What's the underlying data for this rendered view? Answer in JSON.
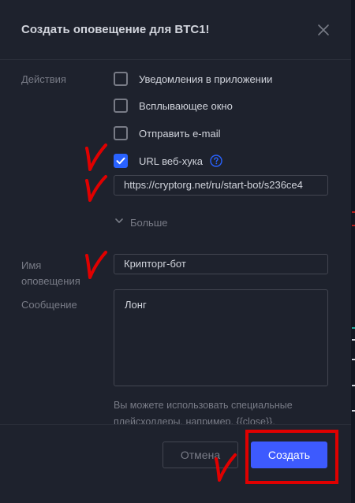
{
  "dialog": {
    "title": "Создать оповещение для BTC1!",
    "close_icon": "close-icon"
  },
  "actions": {
    "label": "Действия",
    "items": [
      {
        "label": "Уведомления в приложении",
        "checked": false
      },
      {
        "label": "Всплывающее окно",
        "checked": false
      },
      {
        "label": "Отправить e-mail",
        "checked": false
      },
      {
        "label": "URL веб-хука",
        "checked": true
      }
    ],
    "webhook_url": "https://cryptorg.net/ru/start-bot/s236ce4",
    "more_label": "Больше",
    "help_icon": "question-circle-icon"
  },
  "alert_name": {
    "label": "Имя оповещения",
    "value": "Крипторг-бот"
  },
  "message": {
    "label": "Сообщение",
    "value": "Лонг",
    "hint": "Вы можете использовать специальные плейсхолдеры, например, {{close}},"
  },
  "footer": {
    "cancel_label": "Отмена",
    "create_label": "Создать"
  },
  "colors": {
    "background": "#1e222d",
    "accent": "#2962ff",
    "create_button": "#3d5afe",
    "annotation": "#e00000"
  }
}
